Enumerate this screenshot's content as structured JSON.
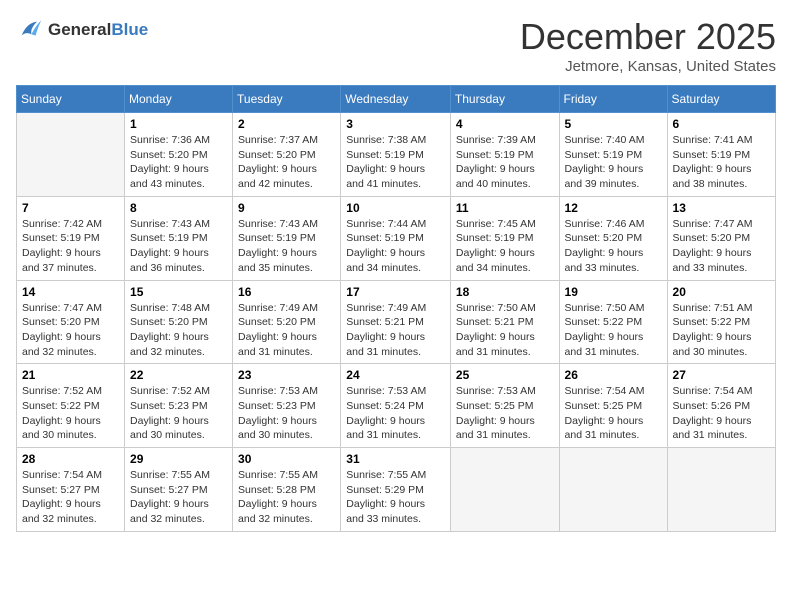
{
  "header": {
    "logo_line1": "General",
    "logo_line2": "Blue",
    "month": "December 2025",
    "location": "Jetmore, Kansas, United States"
  },
  "weekdays": [
    "Sunday",
    "Monday",
    "Tuesday",
    "Wednesday",
    "Thursday",
    "Friday",
    "Saturday"
  ],
  "weeks": [
    [
      {
        "day": "",
        "empty": true
      },
      {
        "day": "1",
        "sunrise": "7:36 AM",
        "sunset": "5:20 PM",
        "daylight": "9 hours and 43 minutes."
      },
      {
        "day": "2",
        "sunrise": "7:37 AM",
        "sunset": "5:20 PM",
        "daylight": "9 hours and 42 minutes."
      },
      {
        "day": "3",
        "sunrise": "7:38 AM",
        "sunset": "5:19 PM",
        "daylight": "9 hours and 41 minutes."
      },
      {
        "day": "4",
        "sunrise": "7:39 AM",
        "sunset": "5:19 PM",
        "daylight": "9 hours and 40 minutes."
      },
      {
        "day": "5",
        "sunrise": "7:40 AM",
        "sunset": "5:19 PM",
        "daylight": "9 hours and 39 minutes."
      },
      {
        "day": "6",
        "sunrise": "7:41 AM",
        "sunset": "5:19 PM",
        "daylight": "9 hours and 38 minutes."
      }
    ],
    [
      {
        "day": "7",
        "sunrise": "7:42 AM",
        "sunset": "5:19 PM",
        "daylight": "9 hours and 37 minutes."
      },
      {
        "day": "8",
        "sunrise": "7:43 AM",
        "sunset": "5:19 PM",
        "daylight": "9 hours and 36 minutes."
      },
      {
        "day": "9",
        "sunrise": "7:43 AM",
        "sunset": "5:19 PM",
        "daylight": "9 hours and 35 minutes."
      },
      {
        "day": "10",
        "sunrise": "7:44 AM",
        "sunset": "5:19 PM",
        "daylight": "9 hours and 34 minutes."
      },
      {
        "day": "11",
        "sunrise": "7:45 AM",
        "sunset": "5:19 PM",
        "daylight": "9 hours and 34 minutes."
      },
      {
        "day": "12",
        "sunrise": "7:46 AM",
        "sunset": "5:20 PM",
        "daylight": "9 hours and 33 minutes."
      },
      {
        "day": "13",
        "sunrise": "7:47 AM",
        "sunset": "5:20 PM",
        "daylight": "9 hours and 33 minutes."
      }
    ],
    [
      {
        "day": "14",
        "sunrise": "7:47 AM",
        "sunset": "5:20 PM",
        "daylight": "9 hours and 32 minutes."
      },
      {
        "day": "15",
        "sunrise": "7:48 AM",
        "sunset": "5:20 PM",
        "daylight": "9 hours and 32 minutes."
      },
      {
        "day": "16",
        "sunrise": "7:49 AM",
        "sunset": "5:20 PM",
        "daylight": "9 hours and 31 minutes."
      },
      {
        "day": "17",
        "sunrise": "7:49 AM",
        "sunset": "5:21 PM",
        "daylight": "9 hours and 31 minutes."
      },
      {
        "day": "18",
        "sunrise": "7:50 AM",
        "sunset": "5:21 PM",
        "daylight": "9 hours and 31 minutes."
      },
      {
        "day": "19",
        "sunrise": "7:50 AM",
        "sunset": "5:22 PM",
        "daylight": "9 hours and 31 minutes."
      },
      {
        "day": "20",
        "sunrise": "7:51 AM",
        "sunset": "5:22 PM",
        "daylight": "9 hours and 30 minutes."
      }
    ],
    [
      {
        "day": "21",
        "sunrise": "7:52 AM",
        "sunset": "5:22 PM",
        "daylight": "9 hours and 30 minutes."
      },
      {
        "day": "22",
        "sunrise": "7:52 AM",
        "sunset": "5:23 PM",
        "daylight": "9 hours and 30 minutes."
      },
      {
        "day": "23",
        "sunrise": "7:53 AM",
        "sunset": "5:23 PM",
        "daylight": "9 hours and 30 minutes."
      },
      {
        "day": "24",
        "sunrise": "7:53 AM",
        "sunset": "5:24 PM",
        "daylight": "9 hours and 31 minutes."
      },
      {
        "day": "25",
        "sunrise": "7:53 AM",
        "sunset": "5:25 PM",
        "daylight": "9 hours and 31 minutes."
      },
      {
        "day": "26",
        "sunrise": "7:54 AM",
        "sunset": "5:25 PM",
        "daylight": "9 hours and 31 minutes."
      },
      {
        "day": "27",
        "sunrise": "7:54 AM",
        "sunset": "5:26 PM",
        "daylight": "9 hours and 31 minutes."
      }
    ],
    [
      {
        "day": "28",
        "sunrise": "7:54 AM",
        "sunset": "5:27 PM",
        "daylight": "9 hours and 32 minutes."
      },
      {
        "day": "29",
        "sunrise": "7:55 AM",
        "sunset": "5:27 PM",
        "daylight": "9 hours and 32 minutes."
      },
      {
        "day": "30",
        "sunrise": "7:55 AM",
        "sunset": "5:28 PM",
        "daylight": "9 hours and 32 minutes."
      },
      {
        "day": "31",
        "sunrise": "7:55 AM",
        "sunset": "5:29 PM",
        "daylight": "9 hours and 33 minutes."
      },
      {
        "day": "",
        "empty": true
      },
      {
        "day": "",
        "empty": true
      },
      {
        "day": "",
        "empty": true
      }
    ]
  ]
}
